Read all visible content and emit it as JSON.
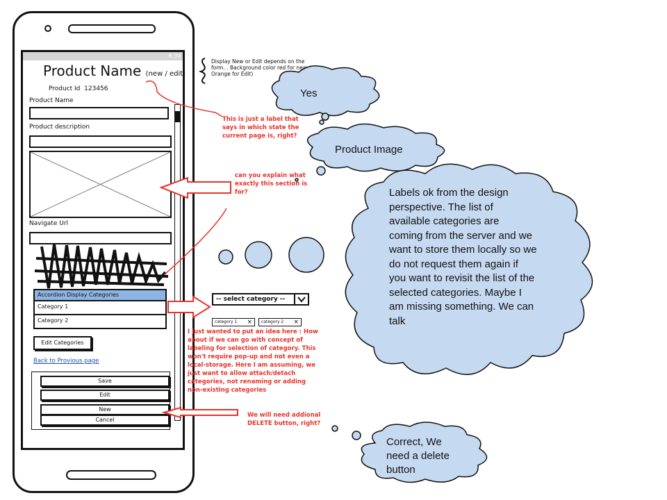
{
  "app": {
    "title": "Product Name",
    "title_suffix": "(new / edit)",
    "status_time": "6:34"
  },
  "form": {
    "product_id_label": "Product Id",
    "product_id_value": "123456",
    "product_name_label": "Product Name",
    "product_description_label": "Product description",
    "navigate_url_label": "Navigate Url",
    "accordion_header": "Accordion Display Categories",
    "categories": [
      "Category 1",
      "Category 2"
    ],
    "edit_categories_label": "Edit Categories",
    "back_link": "Back to Provious page",
    "buttons": [
      "Save",
      "Edit",
      "New",
      "Cancel"
    ]
  },
  "annotations": {
    "state_note": "Display New or Edit depends on the form. . Background color red for new / Orange for Edit)",
    "state_note_lines": [
      "Display New or Edit depends on the",
      "form. . Background color red for new /",
      "Orange for Edit)"
    ],
    "label_question": [
      "This is just a label that",
      "says in which state the",
      "current page is, right?"
    ],
    "section_question": [
      "can you explain what",
      "exactly this section is",
      "for?"
    ],
    "select_placeholder": "-- select category --",
    "tags": [
      "category 1",
      "category 2"
    ],
    "idea_note": [
      "I just wanted to put an idea here : How",
      "about if we can go with concept of",
      "labeling for selection of category. This",
      "won't require pop-up and not even a",
      "local-storage. Here I am assuming, we",
      "just want to allow attach/detach",
      "categories, not renaming or adding",
      "non-existing categories"
    ],
    "delete_note": [
      "We will  need addional",
      "DELETE  button, right?"
    ]
  },
  "clouds": {
    "yes": "Yes",
    "product_image": "Product Image",
    "labels_ok": [
      "Labels ok from the design",
      "perspective. The list of",
      "available  categories are",
      "coming from the server and we",
      "want to store them locally so we",
      "do not request them again if",
      "you want to revisit the list of the",
      "selected categories. Maybe I",
      "am missing something. We can",
      "talk"
    ],
    "correct": [
      "Correct, We",
      "need a delete",
      "button"
    ]
  },
  "colors": {
    "cloud_fill": "#c5d9f1",
    "accordion_header": "#8db4e2",
    "annotation_red": "#e8322b"
  }
}
